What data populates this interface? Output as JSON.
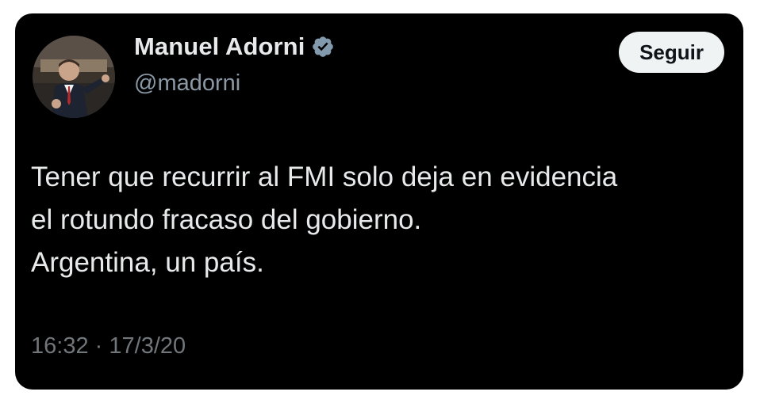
{
  "author": {
    "display_name": "Manuel Adorni",
    "handle": "@madorni",
    "verified": true
  },
  "follow_button": {
    "label": "Seguir"
  },
  "tweet": {
    "lines": [
      "Tener que recurrir al FMI solo deja en evidencia",
      "el rotundo fracaso del gobierno.",
      "Argentina, un país."
    ]
  },
  "meta": {
    "time": "16:32",
    "separator": "·",
    "date": "17/3/20"
  },
  "icons": {
    "verified": "verified-badge-icon"
  },
  "colors": {
    "background": "#000000",
    "text": "#e7e9ea",
    "secondary_text": "#71767b",
    "follow_button_bg": "#eff3f4"
  }
}
